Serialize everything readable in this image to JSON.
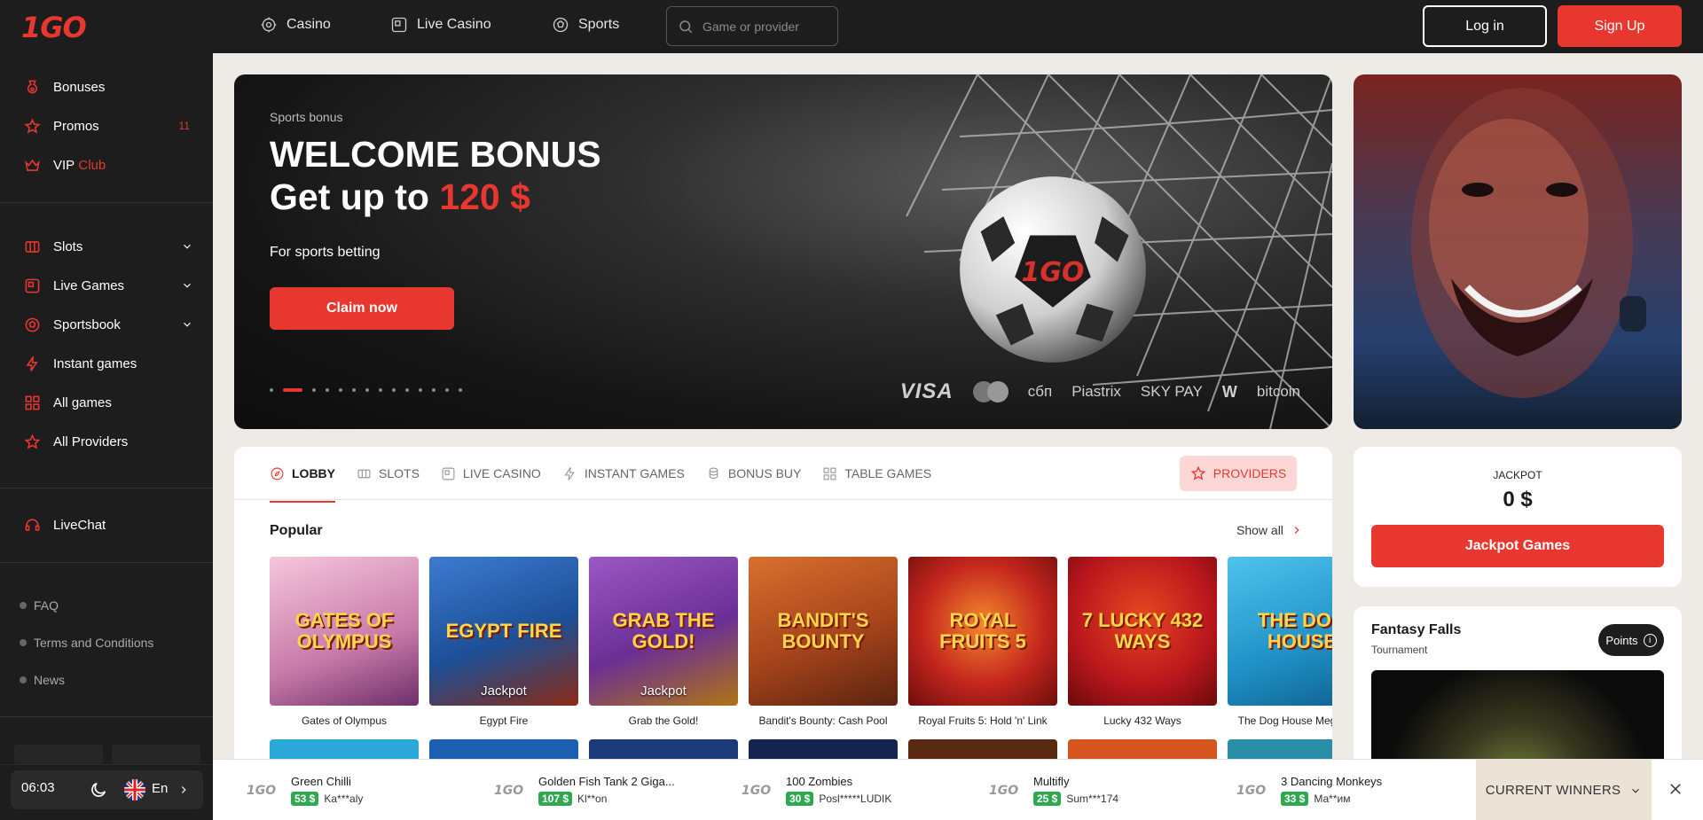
{
  "brand": {
    "logo": "1GO"
  },
  "sidebar": {
    "top_items": [
      {
        "label": "Bonuses",
        "icon": "bonus-icon"
      },
      {
        "label": "Promos",
        "icon": "star-icon",
        "badge": "11"
      },
      {
        "label": "VIP",
        "label_red": "Club",
        "icon": "crown-icon"
      }
    ],
    "game_items": [
      {
        "label": "Slots",
        "icon": "slots-icon"
      },
      {
        "label": "Live Games",
        "icon": "live-icon"
      },
      {
        "label": "Sportsbook",
        "icon": "soccer-ball-icon"
      },
      {
        "label": "Instant games",
        "icon": "lightning-icon"
      },
      {
        "label": "All games",
        "icon": "grid-icon"
      },
      {
        "label": "All Providers",
        "icon": "star-icon"
      }
    ],
    "livechat": "LiveChat",
    "footer_links": [
      "FAQ",
      "Terms and Conditions",
      "News"
    ],
    "time": "06:03",
    "language": "En"
  },
  "topbar": {
    "nav": [
      "Casino",
      "Live Casino",
      "Sports"
    ],
    "search_placeholder": "Game or provider",
    "login": "Log in",
    "signup": "Sign Up"
  },
  "hero": {
    "subtitle": "Sports bonus",
    "title_line1": "WELCOME BONUS",
    "title_line2_prefix": "Get up to ",
    "title_line2_amount": "120 $",
    "description": "For sports betting",
    "button": "Claim now",
    "payments": [
      "VISA",
      "Mastercard",
      "сбп",
      "Piastrix",
      "SKY PAY",
      "W",
      "bitcoin"
    ]
  },
  "tabs": {
    "items": [
      "LOBBY",
      "SLOTS",
      "LIVE CASINO",
      "INSTANT GAMES",
      "BONUS BUY",
      "TABLE GAMES"
    ],
    "providers": "PROVIDERS"
  },
  "popular": {
    "title": "Popular",
    "show_all": "Show all",
    "games": [
      {
        "name": "Gates of Olympus",
        "art": "GATES OF OLYMPUS",
        "bg": "#e9a9c7",
        "badge": ""
      },
      {
        "name": "Egypt Fire",
        "art": "EGYPT FIRE",
        "bg": "#1e5aa8",
        "badge": "Jackpot"
      },
      {
        "name": "Grab the Gold!",
        "art": "GRAB THE GOLD!",
        "bg": "#7a3fa0",
        "badge": "Jackpot"
      },
      {
        "name": "Bandit's Bounty: Cash Pool",
        "art": "BANDIT'S BOUNTY",
        "bg": "#c0521e",
        "badge": ""
      },
      {
        "name": "Royal Fruits 5: Hold 'n' Link",
        "art": "ROYAL FRUITS 5",
        "bg": "#c4261d",
        "badge": ""
      },
      {
        "name": "Lucky 432 Ways",
        "art": "7 LUCKY 432 WAYS",
        "bg": "#b8161d",
        "badge": ""
      },
      {
        "name": "The Dog House Megaways",
        "art": "THE DOG HOUSE",
        "bg": "#29a9d6",
        "badge": ""
      }
    ]
  },
  "jackpot": {
    "label": "JACKPOT",
    "value": "0 $",
    "button": "Jackpot Games"
  },
  "tournament": {
    "title": "Fantasy Falls",
    "subtitle": "Tournament",
    "points": "Points"
  },
  "winners": {
    "logo": "1GO",
    "items": [
      {
        "game": "Green Chilli",
        "amount": "53 $",
        "user": "Ka***aly"
      },
      {
        "game": "Golden Fish Tank 2 Giga...",
        "amount": "107 $",
        "user": "Kl**on"
      },
      {
        "game": "100 Zombies",
        "amount": "30 $",
        "user": "Posl*****LUDIK"
      },
      {
        "game": "Multifly",
        "amount": "25 $",
        "user": "Sum***174"
      },
      {
        "game": "3 Dancing Monkeys",
        "amount": "33 $",
        "user": "Ма**им"
      }
    ],
    "current": "CURRENT WINNERS"
  }
}
